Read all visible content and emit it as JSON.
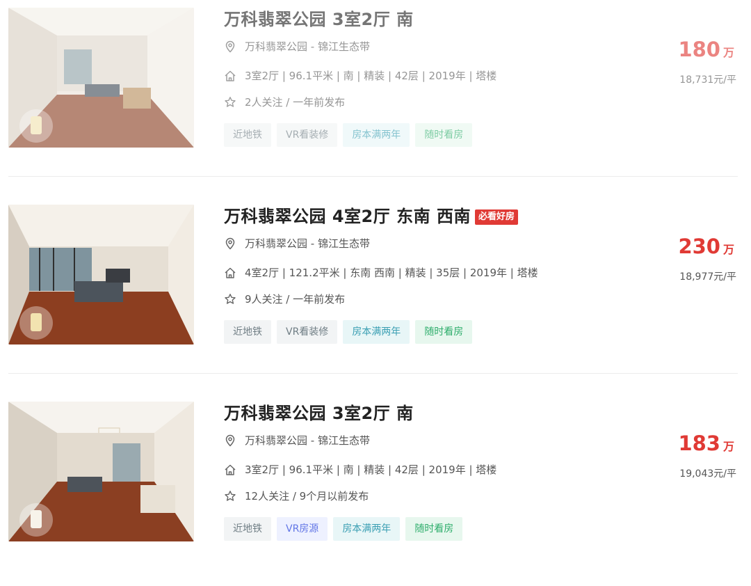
{
  "listings": [
    {
      "title": "万科翡翠公园 3室2厅 南",
      "badge": "",
      "location": "万科翡翠公园 - 锦江生态带",
      "specs": "3室2厅 | 96.1平米 | 南 | 精装 | 42层 | 2019年 | 塔楼",
      "follow": "2人关注 / 一年前发布",
      "tags": [
        "近地铁",
        "VR看装修",
        "房本满两年",
        "随时看房"
      ],
      "price": "180",
      "price_unit": "万",
      "unit_price": "18,731元/平"
    },
    {
      "title": "万科翡翠公园 4室2厅 东南 西南",
      "badge": "必看好房",
      "location": "万科翡翠公园 - 锦江生态带",
      "specs": "4室2厅 | 121.2平米 | 东南 西南 | 精装 | 35层 | 2019年 | 塔楼",
      "follow": "9人关注 / 一年前发布",
      "tags": [
        "近地铁",
        "VR看装修",
        "房本满两年",
        "随时看房"
      ],
      "price": "230",
      "price_unit": "万",
      "unit_price": "18,977元/平"
    },
    {
      "title": "万科翡翠公园 3室2厅 南",
      "badge": "",
      "location": "万科翡翠公园 - 锦江生态带",
      "specs": "3室2厅 | 96.1平米 | 南 | 精装 | 42层 | 2019年 | 塔楼",
      "follow": "12人关注 / 9个月以前发布",
      "tags": [
        "近地铁",
        "VR房源",
        "房本满两年",
        "随时看房"
      ],
      "price": "183",
      "price_unit": "万",
      "unit_price": "19,043元/平"
    }
  ],
  "icons": {
    "location": "location-pin-icon",
    "house": "house-icon",
    "favorite": "star-icon",
    "vr": "vr-3d-icon"
  },
  "colors": {
    "price": "#e03a35",
    "badge": "#e03a35"
  }
}
